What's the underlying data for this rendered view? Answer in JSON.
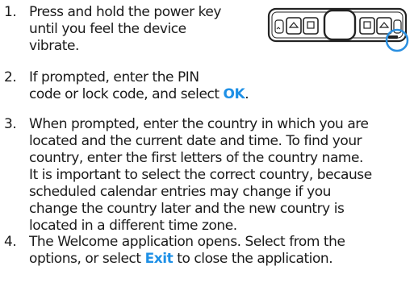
{
  "steps": [
    {
      "number": "1.",
      "lines": [
        "Press and hold the power key",
        "until you feel the device",
        "vibrate."
      ]
    },
    {
      "number": "2.",
      "line1": "If prompted, enter the PIN",
      "line2_before": "code or lock code, and select ",
      "line2_keyword": "OK",
      "line2_after": "."
    },
    {
      "number": "3.",
      "lines": [
        "When prompted, enter the country in which you are",
        "located and the current date and time. To find your",
        "country, enter the first letters of the country name.",
        "It is important to select the correct country, because",
        "scheduled calendar entries may change if you",
        "change the country later and the new country is",
        "located in a different time zone."
      ]
    },
    {
      "number": "4.",
      "line1": "The Welcome application opens. Select from the",
      "line2_before": "options, or select ",
      "line2_keyword": "Exit",
      "line2_after": " to close the application."
    }
  ],
  "colors": {
    "keyword": "#1e90e6",
    "text": "#1a1a1a",
    "highlight_circle": "#2a8fe0"
  },
  "illustration": {
    "icon": "device-top-keys-illustration",
    "highlight": "power-key-highlight-circle"
  }
}
